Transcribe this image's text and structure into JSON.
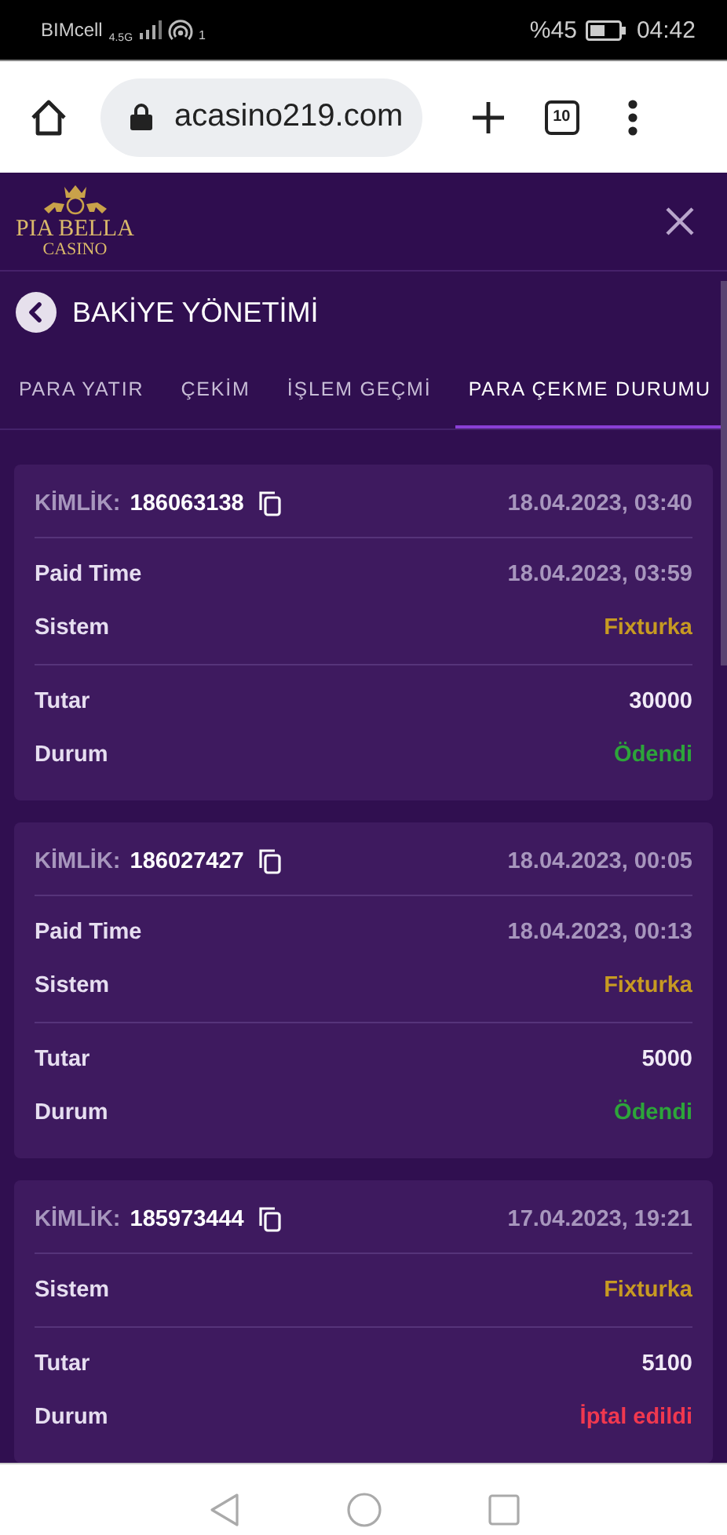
{
  "status_bar": {
    "carrier": "BIMcell",
    "network": "4.5G",
    "hotspot_count": "1",
    "battery": "%45",
    "time": "04:42"
  },
  "browser": {
    "url": "acasino219.com",
    "tab_count": "10"
  },
  "header": {
    "logo_name": "PIA BELLA",
    "logo_sub": "CASINO"
  },
  "page_title": "BAKİYE YÖNETİMİ",
  "tabs": [
    {
      "label": "PARA YATIR",
      "selected": false
    },
    {
      "label": "ÇEKİM",
      "selected": false
    },
    {
      "label": "İŞLEM GEÇMİ",
      "selected": false
    },
    {
      "label": "PARA ÇEKME DURUMU",
      "selected": true
    }
  ],
  "cards": [
    {
      "id_label": "KİMLİK:",
      "id": "186063138",
      "date": "18.04.2023, 03:40",
      "sections": [
        [
          {
            "label": "Paid Time",
            "value": "18.04.2023, 03:59",
            "kind": "date"
          },
          {
            "label": "Sistem",
            "value": "Fixturka",
            "kind": "system"
          }
        ],
        [
          {
            "label": "Tutar",
            "value": "30000",
            "kind": "amount"
          },
          {
            "label": "Durum",
            "value": "Ödendi",
            "kind": "paid"
          }
        ]
      ]
    },
    {
      "id_label": "KİMLİK:",
      "id": "186027427",
      "date": "18.04.2023, 00:05",
      "sections": [
        [
          {
            "label": "Paid Time",
            "value": "18.04.2023, 00:13",
            "kind": "date"
          },
          {
            "label": "Sistem",
            "value": "Fixturka",
            "kind": "system"
          }
        ],
        [
          {
            "label": "Tutar",
            "value": "5000",
            "kind": "amount"
          },
          {
            "label": "Durum",
            "value": "Ödendi",
            "kind": "paid"
          }
        ]
      ]
    },
    {
      "id_label": "KİMLİK:",
      "id": "185973444",
      "date": "17.04.2023, 19:21",
      "sections": [
        [
          {
            "label": "Sistem",
            "value": "Fixturka",
            "kind": "system"
          }
        ],
        [
          {
            "label": "Tutar",
            "value": "5100",
            "kind": "amount"
          },
          {
            "label": "Durum",
            "value": "İptal edildi",
            "kind": "cancelled"
          }
        ]
      ]
    }
  ]
}
